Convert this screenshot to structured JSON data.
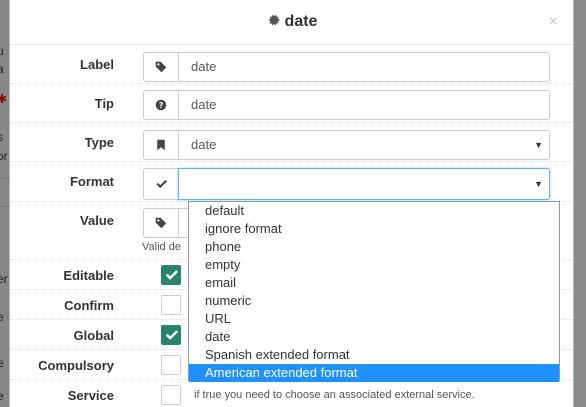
{
  "backdrop": {
    "fragments": [
      "u",
      "a",
      "s",
      "or",
      "er",
      "e",
      "e",
      "e"
    ]
  },
  "modal": {
    "title": "date",
    "close": "×"
  },
  "fields": {
    "label": {
      "label": "Label",
      "value": "date"
    },
    "tip": {
      "label": "Tip",
      "value": "date"
    },
    "type": {
      "label": "Type",
      "value": "date"
    },
    "format": {
      "label": "Format",
      "value": ""
    },
    "value": {
      "label": "Value",
      "help": "Valid de"
    },
    "editable": {
      "label": "Editable",
      "checked": true
    },
    "confirm": {
      "label": "Confirm",
      "checked": false
    },
    "global": {
      "label": "Global",
      "checked": true
    },
    "compulsory": {
      "label": "Compulsory",
      "checked": false
    },
    "service": {
      "label": "Service",
      "checked": false,
      "help": "if true you need to choose an associated external service."
    }
  },
  "format_options": [
    "default",
    "ignore format",
    "phone",
    "empty",
    "email",
    "numeric",
    "URL",
    "date",
    "Spanish extended format",
    "American extended format"
  ],
  "selected_option": "American extended format",
  "colors": {
    "checked": "#27866a",
    "selected": "#1e90ff",
    "focus": "#66afe9"
  }
}
